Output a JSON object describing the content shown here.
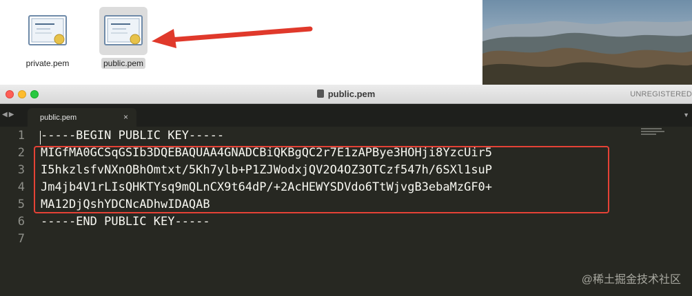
{
  "finder": {
    "files": [
      {
        "name": "private.pem",
        "icon": "certificate-icon",
        "selected": false
      },
      {
        "name": "public.pem",
        "icon": "certificate-icon",
        "selected": true
      }
    ]
  },
  "window": {
    "title": "public.pem",
    "registration": "UNREGISTERED"
  },
  "tabs": [
    {
      "label": "public.pem",
      "close_glyph": "×"
    }
  ],
  "editor": {
    "line_numbers": [
      "1",
      "2",
      "3",
      "4",
      "5",
      "6",
      "7"
    ],
    "lines": [
      "-----BEGIN PUBLIC KEY-----",
      "MIGfMA0GCSqGSIb3DQEBAQUAA4GNADCBiQKBgQC2r7E1zAPBye3HOHji8YzcUir5",
      "I5hkzlsfvNXnOBhOmtxt/5Kh7ylb+P1ZJWodxjQV2O4OZ3OTCzf547h/6SXl1suP",
      "Jm4jb4V1rLIsQHKTYsq9mQLnCX9t64dP/+2AcHEWYSDVdo6TtWjvgB3ebaMzGF0+",
      "MA12DjQshYDCNcADhwIDAQAB",
      "-----END PUBLIC KEY-----",
      ""
    ]
  },
  "watermark": "@稀土掘金技术社区",
  "colors": {
    "highlight_box": "#e64236",
    "arrow": "#e0392b",
    "editor_bg": "#272822",
    "editor_text": "#f8f8f2"
  }
}
